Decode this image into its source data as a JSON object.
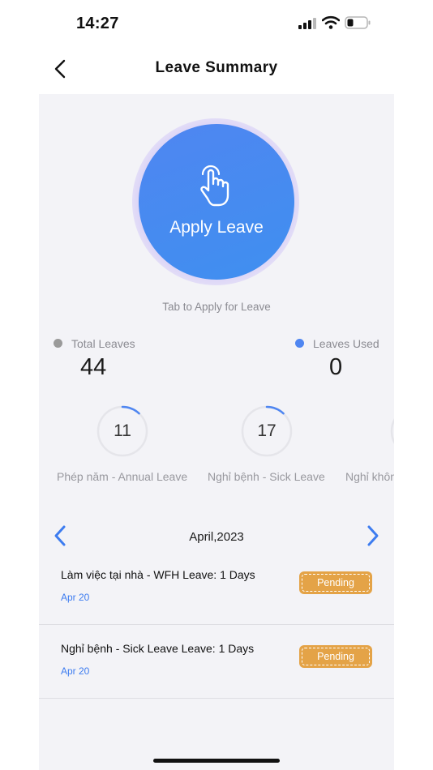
{
  "status_bar": {
    "time": "14:27",
    "icons": [
      "signal-icon",
      "wifi-icon",
      "battery-icon"
    ]
  },
  "nav": {
    "title": "Leave Summary",
    "back_icon": "chevron-left-icon"
  },
  "apply": {
    "label": "Apply Leave",
    "icon": "hand-tap-icon",
    "hint": "Tab to Apply for Leave",
    "color": "#4a8af2"
  },
  "stats": {
    "total": {
      "label": "Total Leaves",
      "value": "44",
      "dot_color": "#9a9a9a"
    },
    "used": {
      "label": "Leaves Used",
      "value": "0",
      "dot_color": "#4f86f1"
    }
  },
  "leave_types": [
    {
      "count": "11",
      "label": "Phép năm - Annual Leave",
      "progress": 0.12
    },
    {
      "count": "17",
      "label": "Nghỉ bệnh - Sick Leave",
      "progress": 0.12
    },
    {
      "count": "",
      "label": "Nghỉ khôn",
      "progress": 0.12
    }
  ],
  "month": {
    "label": "April,2023",
    "prev_icon": "chevron-left-icon",
    "next_icon": "chevron-right-icon"
  },
  "requests": [
    {
      "title": "Làm việc tại nhà - WFH Leave: 1 Days",
      "date": "Apr 20",
      "status": "Pending"
    },
    {
      "title": "Nghỉ bệnh - Sick Leave Leave: 1 Days",
      "date": "Apr 20",
      "status": "Pending"
    }
  ],
  "colors": {
    "accent": "#3d7cf0",
    "pending": "#e4a347",
    "panel": "#f3f3f7"
  }
}
